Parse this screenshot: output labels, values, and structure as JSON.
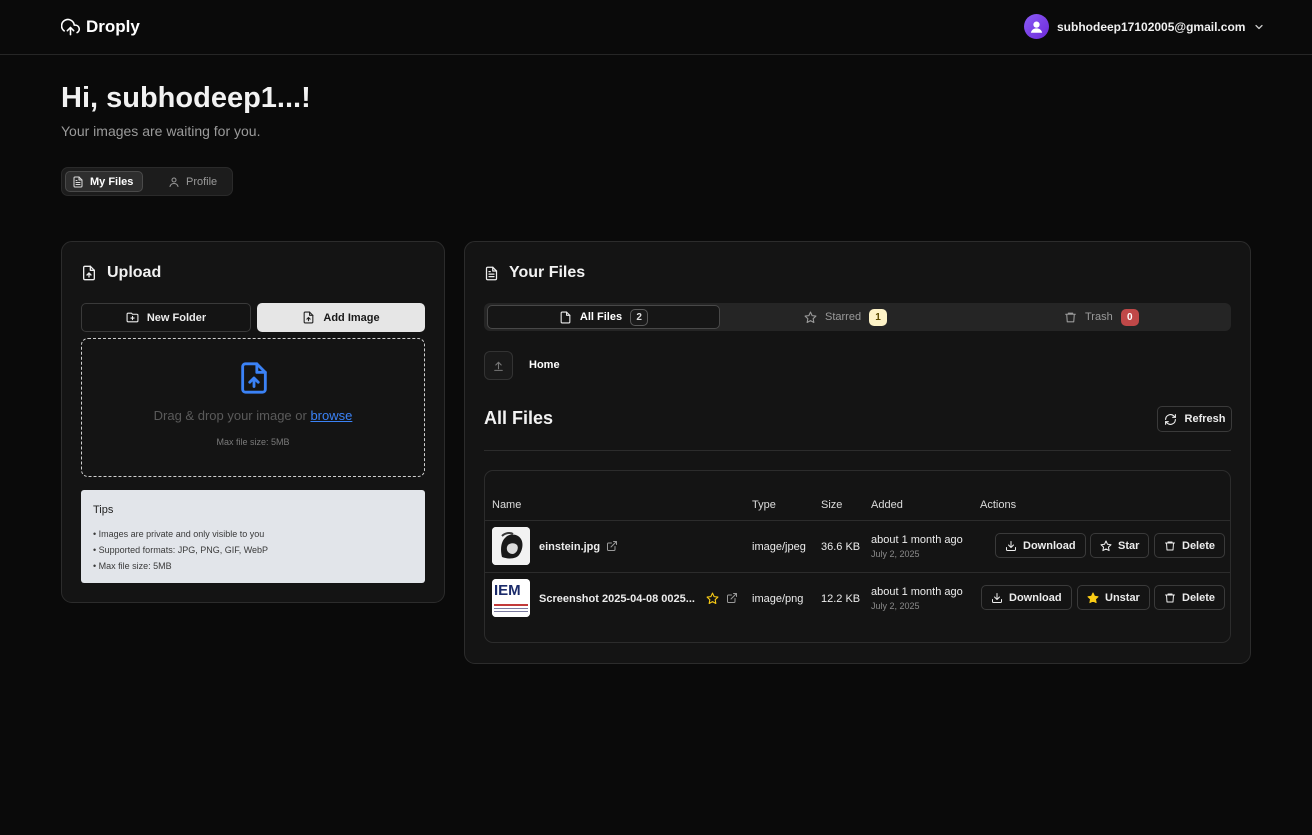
{
  "app": {
    "name": "Droply"
  },
  "user": {
    "email": "subhodeep17102005@gmail.com"
  },
  "greeting": {
    "title": "Hi, subhodeep1...!",
    "subtitle": "Your images are waiting for you."
  },
  "tabs": [
    {
      "label": "My Files",
      "active": true
    },
    {
      "label": "Profile",
      "active": false
    }
  ],
  "upload": {
    "title": "Upload",
    "new_folder_label": "New Folder",
    "add_image_label": "Add Image",
    "dropzone_text": "Drag & drop your image or ",
    "browse_label": "browse",
    "max_size_note": "Max file size: 5MB"
  },
  "tips": {
    "title": "Tips",
    "items": [
      "• Images are private and only visible to you",
      "• Supported formats: JPG, PNG, GIF, WebP",
      "• Max file size: 5MB"
    ]
  },
  "files": {
    "title": "Your Files",
    "tabs": [
      {
        "label": "All Files",
        "count": "2"
      },
      {
        "label": "Starred",
        "count": "1"
      },
      {
        "label": "Trash",
        "count": "0"
      }
    ],
    "breadcrumb": "Home",
    "section_title": "All Files",
    "refresh_label": "Refresh",
    "columns": [
      "Name",
      "Type",
      "Size",
      "Added",
      "Actions"
    ],
    "rows": [
      {
        "name": "einstein.jpg",
        "type": "image/jpeg",
        "size": "36.6 KB",
        "added": "about 1 month ago",
        "date": "July 2, 2025",
        "starred": false,
        "download_label": "Download",
        "star_label": "Star",
        "delete_label": "Delete"
      },
      {
        "name": "Screenshot 2025-04-08 0025...",
        "type": "image/png",
        "size": "12.2 KB",
        "added": "about 1 month ago",
        "date": "July 2, 2025",
        "starred": true,
        "thumb_text": "IEM",
        "download_label": "Download",
        "star_label": "Unstar",
        "delete_label": "Delete"
      }
    ]
  },
  "colors": {
    "accent": "#3b82f6",
    "star": "#facc15",
    "danger": "#c04848"
  }
}
